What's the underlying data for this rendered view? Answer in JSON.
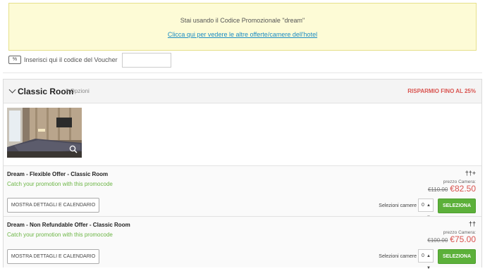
{
  "promo": {
    "text": "Stai usando il Codice Promozionale \"dream\"",
    "link": "Clicca qui per vedere le altre offerte/camere dell'hotel"
  },
  "voucher": {
    "icon": "%",
    "label": "Inserisci qui il codice del Voucher",
    "value": ""
  },
  "room": {
    "title": "Classic Room",
    "options": "2 Opzioni",
    "savings": "RISPARMIO FINO AL 25%",
    "offers": [
      {
        "title": "Dream - Flexible Offer - Classic Room",
        "promo": "Catch your promotion with this promocode",
        "details_button": "MOSTRA DETTAGLI E CALENDARIO",
        "guests_icon": "††+",
        "price_label": "prezzo Camera:",
        "price_old": "€110.00",
        "price_new": "€82.50",
        "select_label": "Selezioni camere",
        "select_value": "0",
        "select_button": "SELEZIONA"
      },
      {
        "title": "Dream - Non Refundable Offer - Classic Room",
        "promo": "Catch your promotion with this promocode",
        "details_button": "MOSTRA DETTAGLI E CALENDARIO",
        "guests_icon": "††",
        "price_label": "prezzo Camera:",
        "price_old": "€100.00",
        "price_new": "€75.00",
        "select_label": "Selezioni camere",
        "select_value": "0",
        "select_button": "SELEZIONA"
      }
    ]
  },
  "colors": {
    "accent_green": "#5cb03a",
    "price_red": "#d9534f",
    "link_blue": "#1a8cc4",
    "promo_bg": "#fdfbd6"
  }
}
